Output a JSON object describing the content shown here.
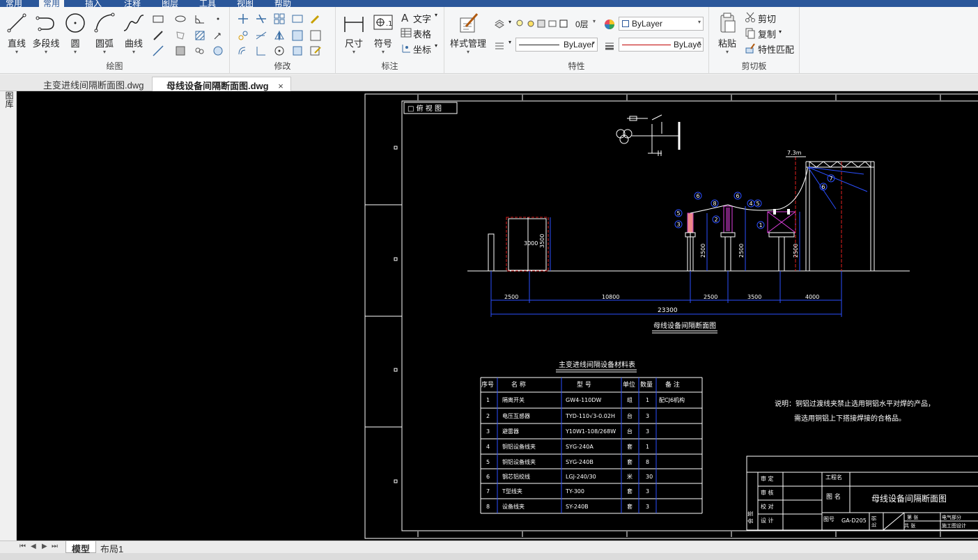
{
  "menu_tabs": [
    "常用",
    "插入",
    "注释",
    "图层",
    "工具",
    "视图",
    "帮助"
  ],
  "ribbon": {
    "draw": {
      "label": "绘图",
      "line": "直线",
      "polyline": "多段线",
      "circle": "圆",
      "arc": "圆弧",
      "spline": "曲线"
    },
    "modify": {
      "label": "修改"
    },
    "annotation": {
      "label": "标注",
      "dimension": "尺寸",
      "symbol": "符号",
      "text": "文字",
      "table": "表格",
      "coord": "坐标"
    },
    "properties": {
      "label": "特性",
      "style_manager": "样式管理",
      "layer": "0层",
      "color": "ByLayer",
      "linetype": "ByLayer",
      "lineweight": "ByLaye"
    },
    "clipboard": {
      "label": "剪切板",
      "paste": "粘贴",
      "cut": "剪切",
      "copy": "复制",
      "match": "特性匹配"
    }
  },
  "doc_tabs": [
    {
      "label": "主变进线间隔断面图.dwg",
      "active": false
    },
    {
      "label": "母线设备间隔断面图.dwg",
      "active": true
    }
  ],
  "side_panel_label": "图库",
  "layout_tabs": [
    "模型",
    "布局1"
  ],
  "drawing": {
    "viewport_label": "□ 俯 视 图",
    "section_title": "母线设备间隔断面图",
    "dims_bottom": [
      "2500",
      "10800",
      "2500",
      "3500",
      "4000"
    ],
    "dim_total": "23300",
    "dim_3000": "3000",
    "dim_3500": "3500",
    "dim_2500a": "2500",
    "dim_2500b": "2500",
    "dim_2500c": "2500",
    "dim_73": "7.3m",
    "callouts": [
      "6",
      "6",
      "5",
      "3",
      "8",
      "2",
      "4",
      "5",
      "1",
      "7",
      "6"
    ],
    "table_title": "主变进线间隔设备材料表",
    "table_headers": [
      "序号",
      "名 称",
      "型 号",
      "单位",
      "数量",
      "备 注"
    ],
    "table_rows": [
      [
        "1",
        "隔离开关",
        "GW4-110DW",
        "组",
        "1",
        "配CJ6机构"
      ],
      [
        "2",
        "电压互感器",
        "TYD-110√3-0.02H",
        "台",
        "3",
        ""
      ],
      [
        "3",
        "避雷器",
        "Y10W1-108/268W",
        "台",
        "3",
        ""
      ],
      [
        "4",
        "铜铝设备线夹",
        "SYG-240A",
        "套",
        "1",
        ""
      ],
      [
        "5",
        "铜铝设备线夹",
        "SYG-240B",
        "套",
        "8",
        ""
      ],
      [
        "6",
        "钢芯铝绞线",
        "LGJ-240/30",
        "米",
        "30",
        ""
      ],
      [
        "7",
        "T型线夹",
        "TY-300",
        "套",
        "3",
        ""
      ],
      [
        "8",
        "设备线夹",
        "SY-240B",
        "套",
        "3",
        ""
      ]
    ],
    "note_line1": "说明：铜铝过渡线夹禁止选用铜铝水平对焊的产品，",
    "note_line2": "需选用铜铝上下搭接焊接的合格品。",
    "titleblock": {
      "title": "母线设备间隔断面图",
      "project_label": "工程名",
      "drawing_name_label": "图 名",
      "drawing_no_label": "图号",
      "drawing_no": "GA-D205",
      "review": "审 定",
      "check": "审 核",
      "proofread": "校 对",
      "design": "设 计",
      "sign": "会 签",
      "ratio": "比 例",
      "sheet": "第 张",
      "sheets_total": "共 张",
      "dept": "电气部分",
      "company": "施工图设计"
    }
  }
}
